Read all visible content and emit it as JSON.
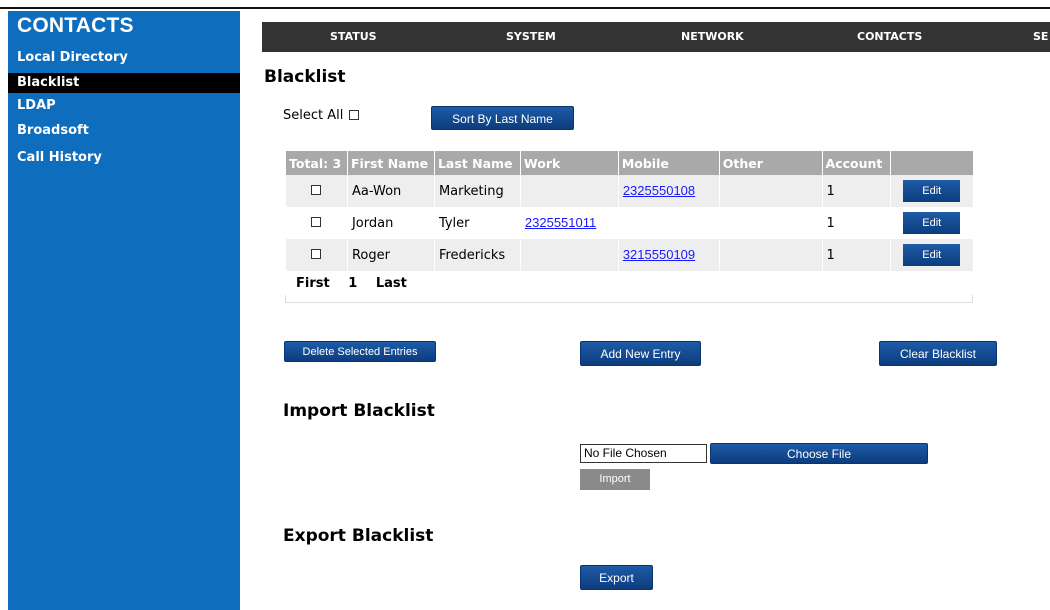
{
  "sidebar": {
    "title": "CONTACTS",
    "items": [
      {
        "label": "Local Directory",
        "active": false
      },
      {
        "label": "Blacklist",
        "active": true
      },
      {
        "label": "LDAP",
        "active": false
      },
      {
        "label": "Broadsoft",
        "active": false
      },
      {
        "label": "Call History",
        "active": false
      }
    ]
  },
  "navbar": {
    "items": [
      "STATUS",
      "SYSTEM",
      "NETWORK",
      "CONTACTS",
      "SE"
    ]
  },
  "blacklist": {
    "heading": "Blacklist",
    "select_all_label": "Select All",
    "sort_button": "Sort By Last Name",
    "columns": [
      "Total: 3",
      "First Name",
      "Last Name",
      "Work",
      "Mobile",
      "Other",
      "Account",
      ""
    ],
    "rows": [
      {
        "first": "Aa-Won",
        "last": "Marketing",
        "work": "",
        "mobile": "2325550108",
        "other": "",
        "account": "1",
        "action": "Edit"
      },
      {
        "first": "Jordan",
        "last": "Tyler",
        "work": "2325551011",
        "mobile": "",
        "other": "",
        "account": "1",
        "action": "Edit"
      },
      {
        "first": "Roger",
        "last": "Fredericks",
        "work": "",
        "mobile": "3215550109",
        "other": "",
        "account": "1",
        "action": "Edit"
      }
    ],
    "pager": {
      "first": "First",
      "page": "1",
      "last": "Last"
    },
    "delete_button": "Delete Selected Entries",
    "add_button": "Add New Entry",
    "clear_button": "Clear Blacklist"
  },
  "import": {
    "heading": "Import Blacklist",
    "file_value": "No File Chosen",
    "choose_button": "Choose File",
    "import_button": "Import"
  },
  "export": {
    "heading": "Export Blacklist",
    "export_button": "Export"
  },
  "colors": {
    "sidebar_bg": "#0f6dbd",
    "navbar_bg": "#333333",
    "button_blue": "#0c3c7e",
    "header_grey": "#a9a9a9",
    "link": "#1a1aff"
  }
}
